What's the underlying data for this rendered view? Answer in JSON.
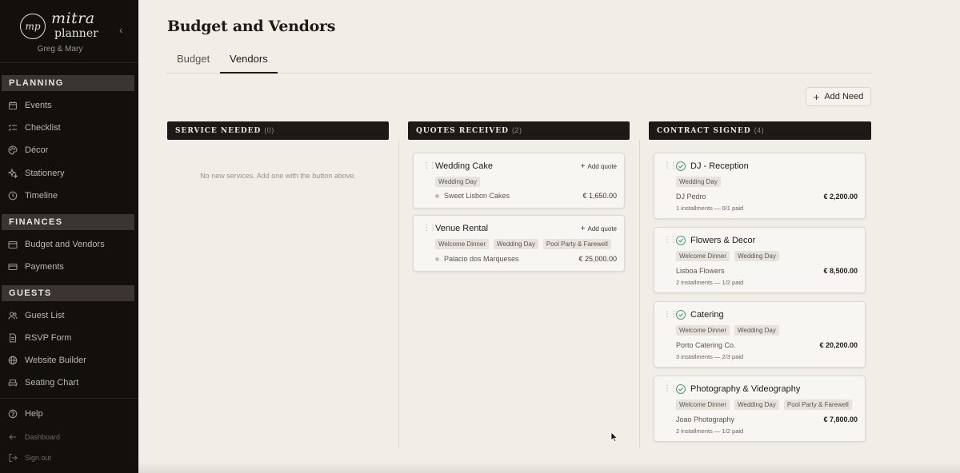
{
  "app": {
    "logo_initials": "mp",
    "logo_top": "mitra",
    "logo_bottom": "planner",
    "couple": "Greg & Mary",
    "collapse_icon": "chevron-left-icon"
  },
  "sidebar": {
    "planning_label": "PLANNING",
    "planning_items": [
      {
        "label": "Events",
        "icon": "calendar-icon"
      },
      {
        "label": "Checklist",
        "icon": "checklist-icon"
      },
      {
        "label": "Décor",
        "icon": "palette-icon"
      },
      {
        "label": "Stationery",
        "icon": "sparkle-icon"
      },
      {
        "label": "Timeline",
        "icon": "clock-icon"
      }
    ],
    "finances_label": "FINANCES",
    "finances_items": [
      {
        "label": "Budget and Vendors",
        "icon": "wallet-icon"
      },
      {
        "label": "Payments",
        "icon": "card-icon"
      }
    ],
    "guests_label": "GUESTS",
    "guests_items": [
      {
        "label": "Guest List",
        "icon": "users-icon"
      },
      {
        "label": "RSVP Form",
        "icon": "document-icon"
      },
      {
        "label": "Website Builder",
        "icon": "globe-icon"
      },
      {
        "label": "Seating Chart",
        "icon": "sofa-icon"
      }
    ],
    "help": "Help",
    "dashboard": "Dashboard",
    "signout": "Sign out"
  },
  "page": {
    "title": "Budget and Vendors",
    "tabs": [
      "Budget",
      "Vendors"
    ],
    "active_tab": "Vendors",
    "add_need": "Add Need"
  },
  "columns": {
    "service_needed": {
      "title": "SERVICE NEEDED",
      "count": "(0)",
      "empty": "No new services. Add one with the button above."
    },
    "quotes_received": {
      "title": "QUOTES RECEIVED",
      "count": "(2)"
    },
    "contract_signed": {
      "title": "CONTRACT SIGNED",
      "count": "(4)"
    }
  },
  "quotes": [
    {
      "title": "Wedding Cake",
      "add_quote": "Add quote",
      "tags": [
        "Wedding Day"
      ],
      "vendor": "Sweet Lisbon Cakes",
      "amount": "€ 1,650.00"
    },
    {
      "title": "Venue Rental",
      "add_quote": "Add quote",
      "tags": [
        "Welcome Dinner",
        "Wedding Day",
        "Pool Party & Farewell"
      ],
      "vendor": "Palacio dos Marqueses",
      "amount": "€ 25,000.00"
    }
  ],
  "contracts": [
    {
      "title": "DJ - Reception",
      "tags": [
        "Wedding Day"
      ],
      "vendor": "DJ Pedro",
      "amount": "€ 2,200.00",
      "installments": "1 installments — 0/1 paid"
    },
    {
      "title": "Flowers & Decor",
      "tags": [
        "Welcome Dinner",
        "Wedding Day"
      ],
      "vendor": "Lisboa Flowers",
      "amount": "€ 8,500.00",
      "installments": "2 installments — 1/2 paid"
    },
    {
      "title": "Catering",
      "tags": [
        "Welcome Dinner",
        "Wedding Day"
      ],
      "vendor": "Porto Catering Co.",
      "amount": "€ 20,200.00",
      "installments": "3 installments — 2/3 paid"
    },
    {
      "title": "Photography & Videography",
      "tags": [
        "Welcome Dinner",
        "Wedding Day",
        "Pool Party & Farewell"
      ],
      "vendor": "Joao Photography",
      "amount": "€ 7,800.00",
      "installments": "2 installments — 1/2 paid"
    }
  ],
  "colors": {
    "sidebar_bg": "#130f0d",
    "page_bg": "#f1eee8",
    "column_header_bg": "#1d1917",
    "check_green": "#4e9a72"
  }
}
